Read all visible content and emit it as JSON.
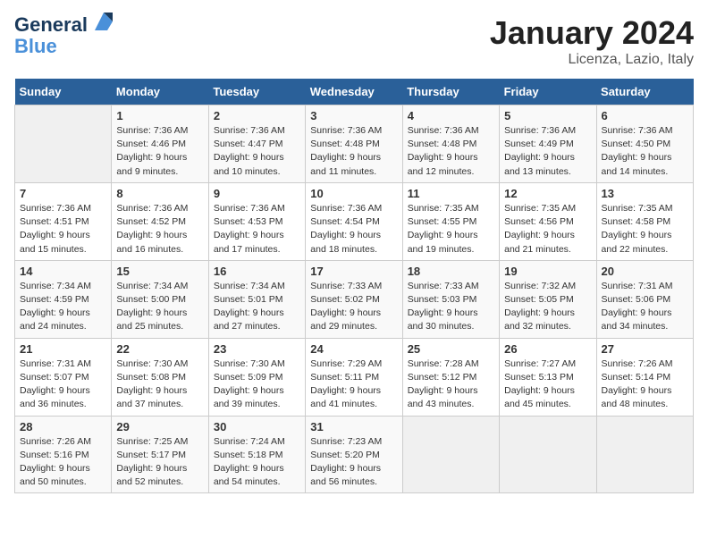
{
  "header": {
    "logo_line1": "General",
    "logo_line2": "Blue",
    "title": "January 2024",
    "subtitle": "Licenza, Lazio, Italy"
  },
  "weekdays": [
    "Sunday",
    "Monday",
    "Tuesday",
    "Wednesday",
    "Thursday",
    "Friday",
    "Saturday"
  ],
  "weeks": [
    [
      {
        "day": "",
        "empty": true
      },
      {
        "day": "1",
        "sunrise": "7:36 AM",
        "sunset": "4:46 PM",
        "daylight": "9 hours and 9 minutes."
      },
      {
        "day": "2",
        "sunrise": "7:36 AM",
        "sunset": "4:47 PM",
        "daylight": "9 hours and 10 minutes."
      },
      {
        "day": "3",
        "sunrise": "7:36 AM",
        "sunset": "4:48 PM",
        "daylight": "9 hours and 11 minutes."
      },
      {
        "day": "4",
        "sunrise": "7:36 AM",
        "sunset": "4:48 PM",
        "daylight": "9 hours and 12 minutes."
      },
      {
        "day": "5",
        "sunrise": "7:36 AM",
        "sunset": "4:49 PM",
        "daylight": "9 hours and 13 minutes."
      },
      {
        "day": "6",
        "sunrise": "7:36 AM",
        "sunset": "4:50 PM",
        "daylight": "9 hours and 14 minutes."
      }
    ],
    [
      {
        "day": "7",
        "sunrise": "7:36 AM",
        "sunset": "4:51 PM",
        "daylight": "9 hours and 15 minutes."
      },
      {
        "day": "8",
        "sunrise": "7:36 AM",
        "sunset": "4:52 PM",
        "daylight": "9 hours and 16 minutes."
      },
      {
        "day": "9",
        "sunrise": "7:36 AM",
        "sunset": "4:53 PM",
        "daylight": "9 hours and 17 minutes."
      },
      {
        "day": "10",
        "sunrise": "7:36 AM",
        "sunset": "4:54 PM",
        "daylight": "9 hours and 18 minutes."
      },
      {
        "day": "11",
        "sunrise": "7:35 AM",
        "sunset": "4:55 PM",
        "daylight": "9 hours and 19 minutes."
      },
      {
        "day": "12",
        "sunrise": "7:35 AM",
        "sunset": "4:56 PM",
        "daylight": "9 hours and 21 minutes."
      },
      {
        "day": "13",
        "sunrise": "7:35 AM",
        "sunset": "4:58 PM",
        "daylight": "9 hours and 22 minutes."
      }
    ],
    [
      {
        "day": "14",
        "sunrise": "7:34 AM",
        "sunset": "4:59 PM",
        "daylight": "9 hours and 24 minutes."
      },
      {
        "day": "15",
        "sunrise": "7:34 AM",
        "sunset": "5:00 PM",
        "daylight": "9 hours and 25 minutes."
      },
      {
        "day": "16",
        "sunrise": "7:34 AM",
        "sunset": "5:01 PM",
        "daylight": "9 hours and 27 minutes."
      },
      {
        "day": "17",
        "sunrise": "7:33 AM",
        "sunset": "5:02 PM",
        "daylight": "9 hours and 29 minutes."
      },
      {
        "day": "18",
        "sunrise": "7:33 AM",
        "sunset": "5:03 PM",
        "daylight": "9 hours and 30 minutes."
      },
      {
        "day": "19",
        "sunrise": "7:32 AM",
        "sunset": "5:05 PM",
        "daylight": "9 hours and 32 minutes."
      },
      {
        "day": "20",
        "sunrise": "7:31 AM",
        "sunset": "5:06 PM",
        "daylight": "9 hours and 34 minutes."
      }
    ],
    [
      {
        "day": "21",
        "sunrise": "7:31 AM",
        "sunset": "5:07 PM",
        "daylight": "9 hours and 36 minutes."
      },
      {
        "day": "22",
        "sunrise": "7:30 AM",
        "sunset": "5:08 PM",
        "daylight": "9 hours and 37 minutes."
      },
      {
        "day": "23",
        "sunrise": "7:30 AM",
        "sunset": "5:09 PM",
        "daylight": "9 hours and 39 minutes."
      },
      {
        "day": "24",
        "sunrise": "7:29 AM",
        "sunset": "5:11 PM",
        "daylight": "9 hours and 41 minutes."
      },
      {
        "day": "25",
        "sunrise": "7:28 AM",
        "sunset": "5:12 PM",
        "daylight": "9 hours and 43 minutes."
      },
      {
        "day": "26",
        "sunrise": "7:27 AM",
        "sunset": "5:13 PM",
        "daylight": "9 hours and 45 minutes."
      },
      {
        "day": "27",
        "sunrise": "7:26 AM",
        "sunset": "5:14 PM",
        "daylight": "9 hours and 48 minutes."
      }
    ],
    [
      {
        "day": "28",
        "sunrise": "7:26 AM",
        "sunset": "5:16 PM",
        "daylight": "9 hours and 50 minutes."
      },
      {
        "day": "29",
        "sunrise": "7:25 AM",
        "sunset": "5:17 PM",
        "daylight": "9 hours and 52 minutes."
      },
      {
        "day": "30",
        "sunrise": "7:24 AM",
        "sunset": "5:18 PM",
        "daylight": "9 hours and 54 minutes."
      },
      {
        "day": "31",
        "sunrise": "7:23 AM",
        "sunset": "5:20 PM",
        "daylight": "9 hours and 56 minutes."
      },
      {
        "day": "",
        "empty": true
      },
      {
        "day": "",
        "empty": true
      },
      {
        "day": "",
        "empty": true
      }
    ]
  ]
}
